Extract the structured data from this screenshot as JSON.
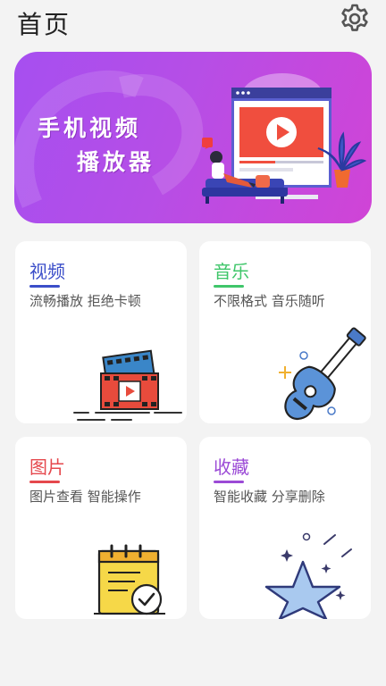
{
  "header": {
    "title": "首页",
    "settings_icon": "gear-icon"
  },
  "banner": {
    "line1": "手机视频",
    "line2": "播放器"
  },
  "cards": [
    {
      "title": "视频",
      "subtitle": "流畅播放 拒绝卡顿",
      "accent": "#3b4ec9",
      "icon": "film-play-icon"
    },
    {
      "title": "音乐",
      "subtitle": "不限格式 音乐随听",
      "accent": "#3fc66a",
      "icon": "guitar-icon"
    },
    {
      "title": "图片",
      "subtitle": "图片查看 智能操作",
      "accent": "#e5484d",
      "icon": "notepad-check-icon"
    },
    {
      "title": "收藏",
      "subtitle": "智能收藏 分享删除",
      "accent": "#9b4ad6",
      "icon": "star-icon"
    }
  ]
}
